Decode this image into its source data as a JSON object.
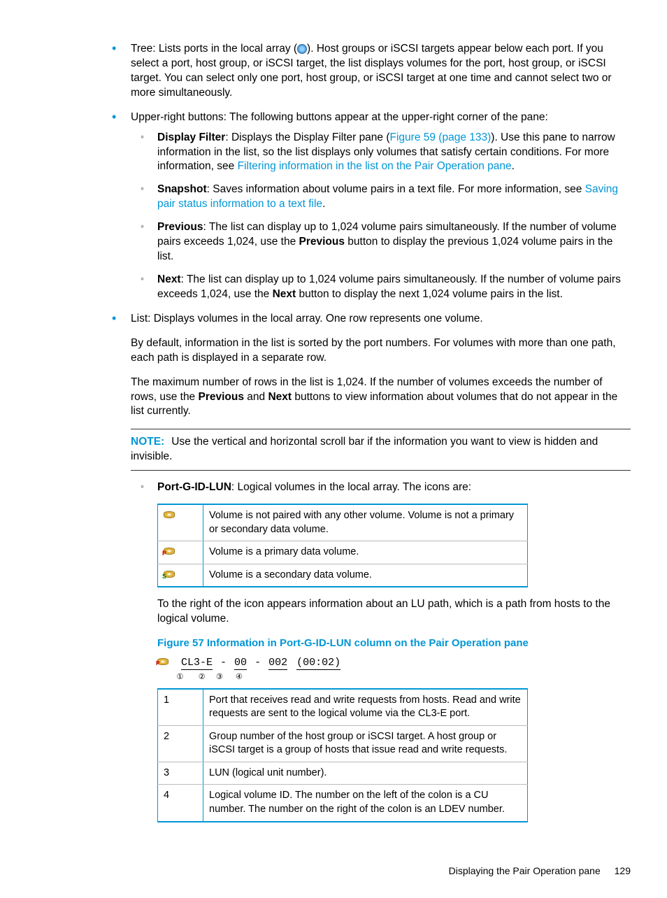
{
  "bullets": {
    "tree": {
      "lead": "Tree: Lists ports in the local array (",
      "tail": "). Host groups or iSCSI targets appear below each port. If you select a port, host group, or iSCSI target, the list displays volumes for the port, host group, or iSCSI target. You can select only one port, host group, or iSCSI target at one time and cannot select two or more simultaneously."
    },
    "upper": {
      "text": "Upper-right buttons: The following buttons appear at the upper-right corner of the pane:",
      "items": {
        "displayFilter": {
          "label": "Display Filter",
          "text1": ": Displays the Display Filter pane (",
          "link1": "Figure 59 (page 133)",
          "text2": "). Use this pane to narrow information in the list, so the list displays only volumes that satisfy certain conditions. For more information, see ",
          "link2": "Filtering information in the list on the Pair Operation pane",
          "text3": "."
        },
        "snapshot": {
          "label": "Snapshot",
          "text1": ": Saves information about volume pairs in a text file. For more information, see ",
          "link1": "Saving pair status information to a text file",
          "text2": "."
        },
        "previous": {
          "label": "Previous",
          "text1": ": The list can display up to 1,024 volume pairs simultaneously. If the number of volume pairs exceeds 1,024, use the ",
          "bold1": "Previous",
          "text2": " button to display the previous 1,024 volume pairs in the list."
        },
        "next": {
          "label": "Next",
          "text1": ": The list can display up to 1,024 volume pairs simultaneously. If the number of volume pairs exceeds 1,024, use the ",
          "bold1": "Next",
          "text2": " button to display the next 1,024 volume pairs in the list."
        }
      }
    },
    "list": {
      "p1": "List: Displays volumes in the local array. One row represents one volume.",
      "p2": "By default, information in the list is sorted by the port numbers. For volumes with more than one path, each path is displayed in a separate row.",
      "p3a": "The maximum number of rows in the list is 1,024. If the number of volumes exceeds the number of rows, use the ",
      "b1": "Previous",
      "mid": " and ",
      "b2": "Next",
      "p3b": " buttons to view information about volumes that do not appear in the list currently."
    }
  },
  "note": {
    "label": "NOTE:",
    "text": "Use the vertical and horizontal scroll bar if the information you want to view is hidden and invisible."
  },
  "portgidlun": {
    "label": "Port-G-ID-LUN",
    "text": ": Logical volumes in the local array. The icons are:"
  },
  "iconTable": [
    {
      "icon": "plain",
      "desc": "Volume is not paired with any other volume. Volume is not a primary or secondary data volume."
    },
    {
      "icon": "p",
      "desc": "Volume is a primary data volume."
    },
    {
      "icon": "s",
      "desc": "Volume is a secondary data volume."
    }
  ],
  "afterIcons": "To the right of the icon appears information about an LU path, which is a path from hosts to the logical volume.",
  "figureCaption": "Figure 57 Information in Port-G-ID-LUN column on the Pair Operation pane",
  "figureSample": {
    "parts": [
      "CL3-E",
      "00",
      "002",
      "(00:02)"
    ],
    "markers": [
      "①",
      "②",
      "③",
      "④"
    ]
  },
  "legendTable": [
    {
      "n": "1",
      "desc": "Port that receives read and write requests from hosts. Read and write requests are sent to the logical volume via the CL3-E port."
    },
    {
      "n": "2",
      "desc": "Group number of the host group or iSCSI target. A host group or iSCSI target is a group of hosts that issue read and write requests."
    },
    {
      "n": "3",
      "desc": "LUN (logical unit number)."
    },
    {
      "n": "4",
      "desc": "Logical volume ID. The number on the left of the colon is a CU number. The number on the right of the colon is an LDEV number."
    }
  ],
  "footer": {
    "title": "Displaying the Pair Operation pane",
    "page": "129"
  }
}
